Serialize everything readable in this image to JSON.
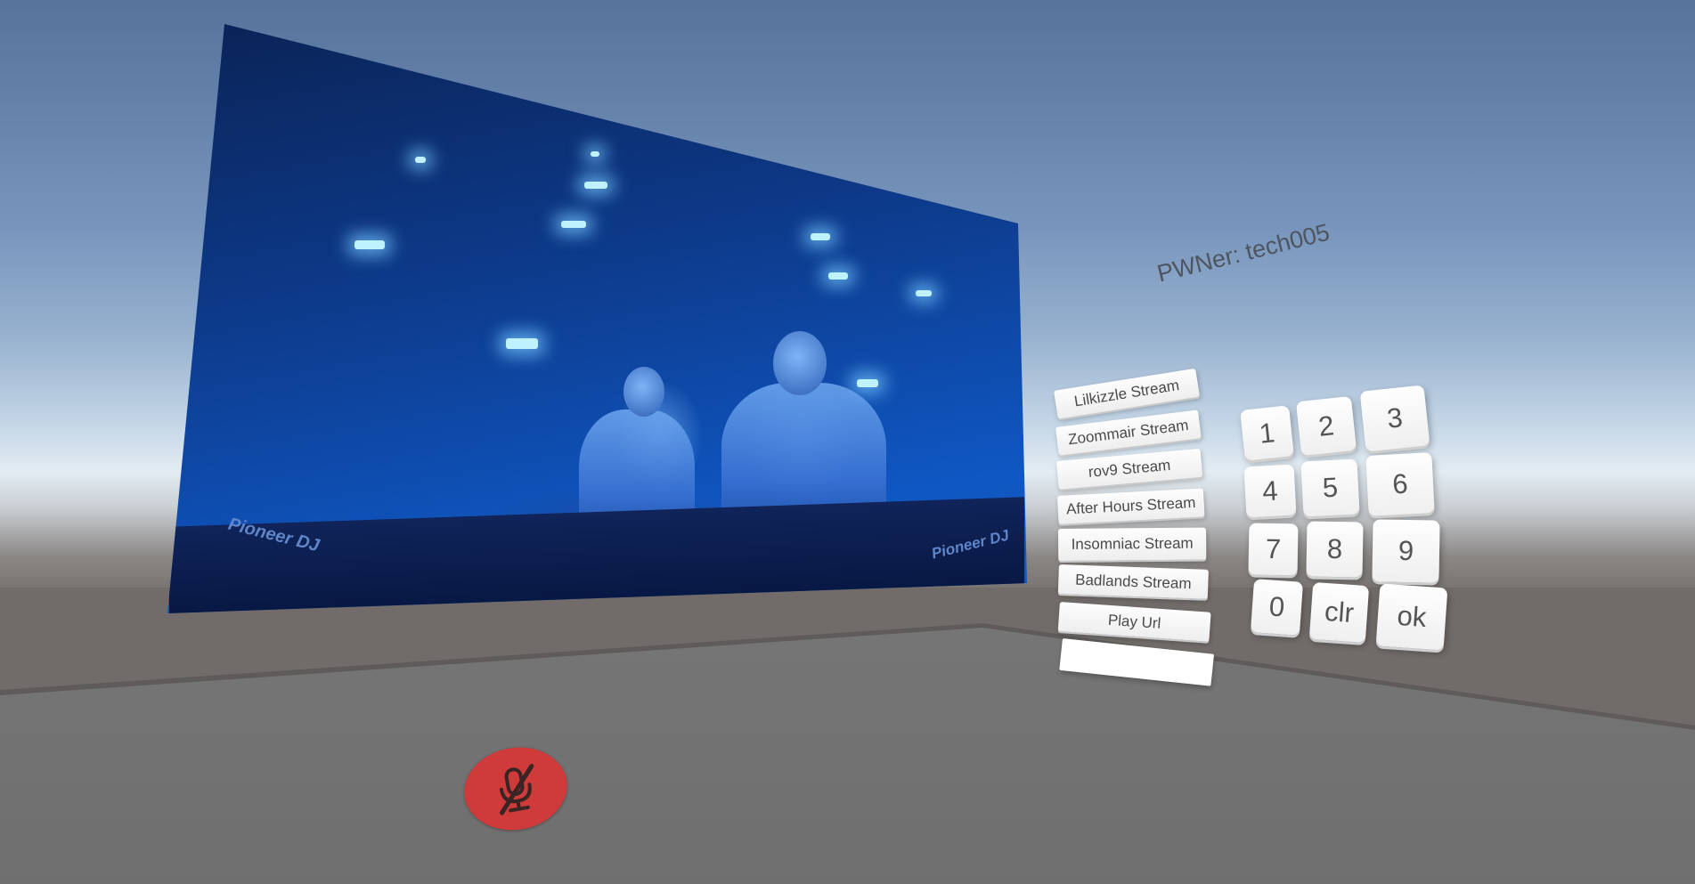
{
  "scene": {
    "owner_label": "PWNer: tech005"
  },
  "video": {
    "deck_brand_left": "Pioneer DJ",
    "deck_brand_right": "Pioneer DJ"
  },
  "stream_menu": {
    "items": [
      {
        "label": "Lilkizzle Stream"
      },
      {
        "label": "Zoommair Stream"
      },
      {
        "label": "rov9 Stream"
      },
      {
        "label": "After Hours Stream"
      },
      {
        "label": "Insomniac Stream"
      },
      {
        "label": "Badlands Stream"
      },
      {
        "label": "Play Url"
      }
    ],
    "url_input": {
      "value": "",
      "placeholder": ""
    }
  },
  "keypad": {
    "keys": [
      {
        "label": "1"
      },
      {
        "label": "2"
      },
      {
        "label": "3"
      },
      {
        "label": "4"
      },
      {
        "label": "5"
      },
      {
        "label": "6"
      },
      {
        "label": "7"
      },
      {
        "label": "8"
      },
      {
        "label": "9"
      },
      {
        "label": "0"
      },
      {
        "label": "clr"
      },
      {
        "label": "ok"
      }
    ]
  },
  "controls": {
    "mute_icon": "microphone-muted-icon",
    "mute_color": "#cf3a3a"
  }
}
